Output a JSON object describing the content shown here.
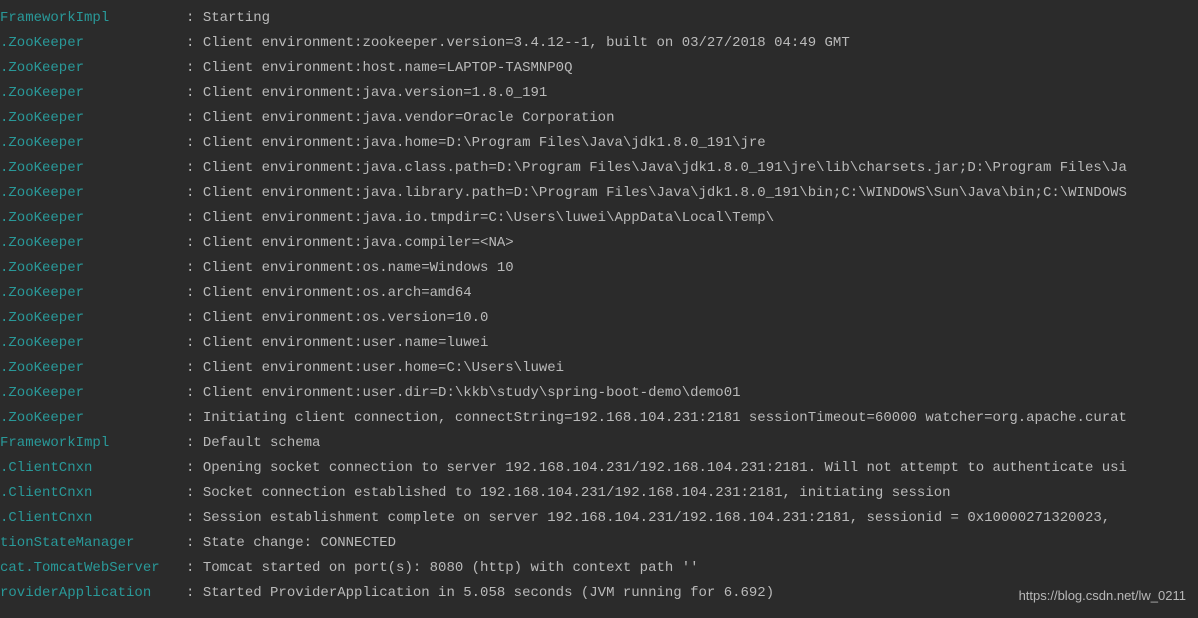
{
  "separator": ": ",
  "watermark": "https://blog.csdn.net/lw_0211",
  "lines": [
    {
      "source": "FrameworkImpl",
      "msg": "Starting"
    },
    {
      "source": ".ZooKeeper",
      "msg": "Client environment:zookeeper.version=3.4.12--1, built on 03/27/2018 04:49 GMT"
    },
    {
      "source": ".ZooKeeper",
      "msg": "Client environment:host.name=LAPTOP-TASMNP0Q"
    },
    {
      "source": ".ZooKeeper",
      "msg": "Client environment:java.version=1.8.0_191"
    },
    {
      "source": ".ZooKeeper",
      "msg": "Client environment:java.vendor=Oracle Corporation"
    },
    {
      "source": ".ZooKeeper",
      "msg": "Client environment:java.home=D:\\Program Files\\Java\\jdk1.8.0_191\\jre"
    },
    {
      "source": ".ZooKeeper",
      "msg": "Client environment:java.class.path=D:\\Program Files\\Java\\jdk1.8.0_191\\jre\\lib\\charsets.jar;D:\\Program Files\\Ja"
    },
    {
      "source": ".ZooKeeper",
      "msg": "Client environment:java.library.path=D:\\Program Files\\Java\\jdk1.8.0_191\\bin;C:\\WINDOWS\\Sun\\Java\\bin;C:\\WINDOWS"
    },
    {
      "source": ".ZooKeeper",
      "msg": "Client environment:java.io.tmpdir=C:\\Users\\luwei\\AppData\\Local\\Temp\\"
    },
    {
      "source": ".ZooKeeper",
      "msg": "Client environment:java.compiler=<NA>"
    },
    {
      "source": ".ZooKeeper",
      "msg": "Client environment:os.name=Windows 10"
    },
    {
      "source": ".ZooKeeper",
      "msg": "Client environment:os.arch=amd64"
    },
    {
      "source": ".ZooKeeper",
      "msg": "Client environment:os.version=10.0"
    },
    {
      "source": ".ZooKeeper",
      "msg": "Client environment:user.name=luwei"
    },
    {
      "source": ".ZooKeeper",
      "msg": "Client environment:user.home=C:\\Users\\luwei"
    },
    {
      "source": ".ZooKeeper",
      "msg": "Client environment:user.dir=D:\\kkb\\study\\spring-boot-demo\\demo01"
    },
    {
      "source": ".ZooKeeper",
      "msg": "Initiating client connection, connectString=192.168.104.231:2181 sessionTimeout=60000 watcher=org.apache.curat"
    },
    {
      "source": "FrameworkImpl",
      "msg": "Default schema"
    },
    {
      "source": ".ClientCnxn",
      "msg": "Opening socket connection to server 192.168.104.231/192.168.104.231:2181. Will not attempt to authenticate usi"
    },
    {
      "source": ".ClientCnxn",
      "msg": "Socket connection established to 192.168.104.231/192.168.104.231:2181, initiating session"
    },
    {
      "source": ".ClientCnxn",
      "msg": "Session establishment complete on server 192.168.104.231/192.168.104.231:2181, sessionid = 0x10000271320023, "
    },
    {
      "source": "tionStateManager",
      "msg": "State change: CONNECTED"
    },
    {
      "source": "cat.TomcatWebServer",
      "msg": "Tomcat started on port(s): 8080 (http) with context path ''"
    },
    {
      "source": "roviderApplication",
      "msg": "Started ProviderApplication in 5.058 seconds (JVM running for 6.692)"
    }
  ]
}
